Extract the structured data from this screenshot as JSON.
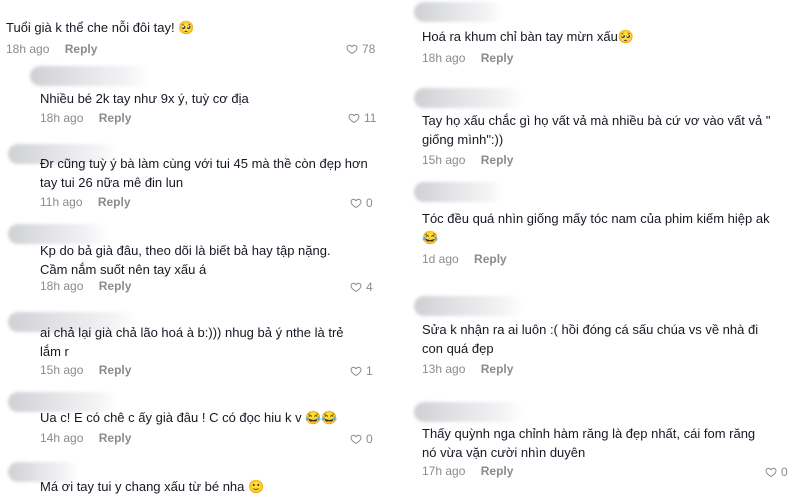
{
  "left_comments": [
    {
      "text": "Tuổi già k thể che nỗi đôi tay! 🥺",
      "time": "18h ago",
      "reply": "Reply",
      "likes": "78"
    },
    {
      "text": "Nhiều bé 2k tay như 9x ý, tuỳ cơ địa",
      "time": "18h ago",
      "reply": "Reply",
      "likes": "11"
    },
    {
      "text": "Đr cũng tuỳ ý bà làm cùng với tui 45 mà thề còn đẹp hơn tay tui 26 nữa mê đin lun",
      "time": "11h ago",
      "reply": "Reply",
      "likes": "0"
    },
    {
      "text": "Kp do bả già đâu, theo dõi là biết bả hay tập nặng. Cầm nắm suốt nên tay xấu á",
      "time": "18h ago",
      "reply": "Reply",
      "likes": "4"
    },
    {
      "text": "ai chả lại già chả lão hoá à b:))) nhug bả ý nthe là trẻ lắm r",
      "time": "15h ago",
      "reply": "Reply",
      "likes": "1"
    },
    {
      "text": "Ua c! E có chê c ấy già đâu ! C có đọc hiu k v 😂😂",
      "time": "14h ago",
      "reply": "Reply",
      "likes": "0"
    },
    {
      "text": "Má ơi tay tui y chang xấu từ bé nha 🙂",
      "time": "",
      "reply": "",
      "likes": ""
    }
  ],
  "right_comments": [
    {
      "text": "Hoá ra khum chỉ bàn tay mừn xấu🥺",
      "time": "18h ago",
      "reply": "Reply",
      "likes": ""
    },
    {
      "text": "Tay họ xấu chắc gì họ vất vả mà nhiều bà cứ vơ vào vất vả \" giống mình\":))",
      "time": "15h ago",
      "reply": "Reply",
      "likes": ""
    },
    {
      "text": "Tóc đều quá nhìn giống mấy tóc nam của phim kiếm hiệp ak 😂",
      "time": "1d ago",
      "reply": "Reply",
      "likes": ""
    },
    {
      "text": "Sửa k nhận ra ai luôn :( hồi đóng cá sấu chúa vs về nhà đi con quá đẹp",
      "time": "13h ago",
      "reply": "Reply",
      "likes": ""
    },
    {
      "text": "Thấy quỳnh nga chỉnh hàm răng là đẹp nhất, cái fom răng nó vừa vặn cười nhìn duyên",
      "time": "17h ago",
      "reply": "Reply",
      "likes": "0"
    }
  ],
  "colors": {
    "text": "#161823",
    "muted": "#8a8b91",
    "background": "#ffffff"
  }
}
